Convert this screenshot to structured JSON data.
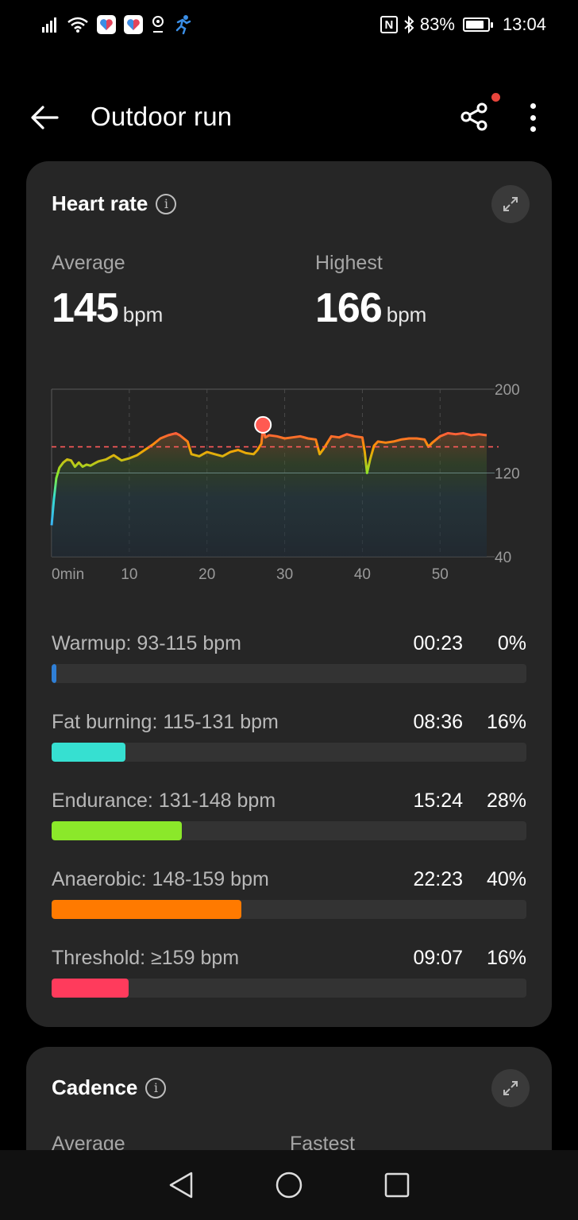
{
  "status_bar": {
    "battery": "83%",
    "battery_level": 0.83,
    "time": "13:04"
  },
  "header": {
    "title": "Outdoor run"
  },
  "heart_rate": {
    "title": "Heart rate",
    "average_label": "Average",
    "average_value": "145",
    "highest_label": "Highest",
    "highest_value": "166",
    "unit": "bpm",
    "zones": [
      {
        "label": "Warmup: 93-115 bpm",
        "time": "00:23",
        "pct": "0%",
        "fill": 0.01,
        "color": "#2f7fd6"
      },
      {
        "label": "Fat burning: 115-131 bpm",
        "time": "08:36",
        "pct": "16%",
        "fill": 0.155,
        "color": "#36e0d1"
      },
      {
        "label": "Endurance: 131-148 bpm",
        "time": "15:24",
        "pct": "28%",
        "fill": 0.275,
        "color": "#8be82a"
      },
      {
        "label": "Anaerobic: 148-159 bpm",
        "time": "22:23",
        "pct": "40%",
        "fill": 0.4,
        "color": "#ff7a00"
      },
      {
        "label": "Threshold: ≥159 bpm",
        "time": "09:07",
        "pct": "16%",
        "fill": 0.163,
        "color": "#ff3b5c"
      }
    ]
  },
  "chart_data": {
    "type": "line",
    "x_ticks": [
      "0min",
      "10",
      "20",
      "30",
      "40",
      "50"
    ],
    "y_ticks": [
      "200",
      "120",
      "40"
    ],
    "ylim": [
      40,
      200
    ],
    "xlim": [
      0,
      56
    ],
    "average_line": 145,
    "highest_marker": {
      "x": 27.2,
      "y": 166
    },
    "series": [
      {
        "x": [
          0,
          0.3,
          0.6,
          1,
          1.5,
          2,
          2.5,
          3,
          3.5,
          4,
          4.5,
          5,
          5.5,
          6,
          7,
          8,
          9,
          10,
          11,
          12,
          13,
          14,
          15,
          16,
          16.5,
          17,
          17.5,
          18,
          19,
          20,
          21,
          22,
          23,
          24,
          25,
          26,
          26.5,
          27,
          27.2,
          27.5,
          28,
          29,
          30,
          31,
          32,
          33,
          34,
          34.5,
          35,
          36,
          37,
          38,
          39,
          40,
          40.3,
          40.6,
          41,
          41.5,
          42,
          43,
          44,
          45,
          46,
          47,
          48,
          48.5,
          49,
          50,
          51,
          52,
          53,
          54,
          55,
          56
        ],
        "y": [
          70,
          95,
          115,
          125,
          130,
          133,
          132,
          126,
          130,
          126,
          128,
          127,
          129,
          131,
          133,
          137,
          132,
          134,
          137,
          142,
          147,
          153,
          156,
          158,
          156,
          153,
          150,
          138,
          136,
          140,
          138,
          136,
          140,
          142,
          139,
          138,
          142,
          148,
          163,
          154,
          156,
          155,
          153,
          154,
          155,
          153,
          152,
          138,
          143,
          155,
          154,
          157,
          155,
          154,
          140,
          120,
          133,
          146,
          150,
          149,
          150,
          152,
          153,
          153,
          152,
          145,
          149,
          155,
          158,
          157,
          158,
          156,
          157,
          156
        ]
      }
    ]
  },
  "cadence": {
    "title": "Cadence",
    "average_label": "Average",
    "fastest_label": "Fastest"
  },
  "icons": {
    "back": "arrow-left-icon",
    "share": "share-icon",
    "more": "more-vertical-icon",
    "expand": "expand-icon",
    "info": "info-icon"
  }
}
